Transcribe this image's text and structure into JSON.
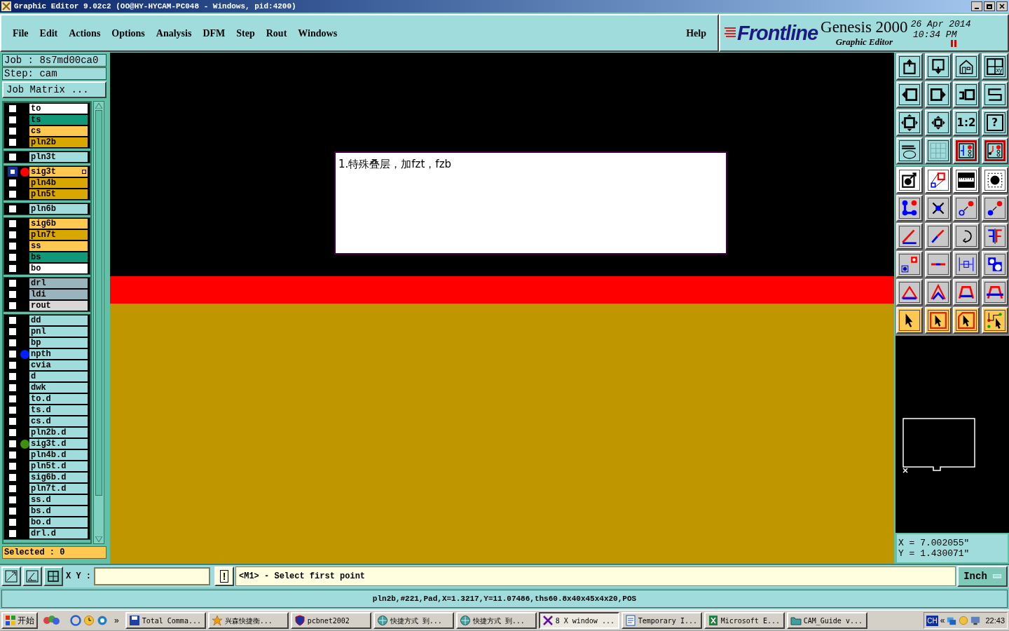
{
  "window": {
    "title": "Graphic Editor 9.02c2 (OO@HY-HYCAM-PC048 - Windows, pid:4200)"
  },
  "menu": {
    "items": [
      "File",
      "Edit",
      "Actions",
      "Options",
      "Analysis",
      "DFM",
      "Step",
      "Rout",
      "Windows"
    ],
    "help": "Help"
  },
  "branding": {
    "logo": "Frontline",
    "product": "Genesis 2000",
    "subtitle": "Graphic Editor",
    "date": "26 Apr 2014",
    "time": "10:34 PM"
  },
  "job": {
    "job": "Job : 8s7md00ca0",
    "step": "Step: cam",
    "matrix_button": "Job Matrix ..."
  },
  "layer_groups": [
    [
      {
        "name": "to",
        "color": "#ffffff",
        "active": false
      },
      {
        "name": "ts",
        "color": "#109878",
        "active": false
      },
      {
        "name": "cs",
        "color": "#ffc850",
        "active": false
      },
      {
        "name": "pln2b",
        "color": "#d8a800",
        "active": false
      }
    ],
    [
      {
        "name": "pln3t",
        "color": "#a0dcdc",
        "active": false
      }
    ],
    [
      {
        "name": "sig3t",
        "color": "#ffc850",
        "active": true,
        "marker": {
          "color": "#ff0000"
        }
      },
      {
        "name": "pln4b",
        "color": "#d8a800",
        "active": false
      },
      {
        "name": "pln5t",
        "color": "#d8a800",
        "active": false
      }
    ],
    [
      {
        "name": "pln6b",
        "color": "#a0dcdc",
        "active": false
      }
    ],
    [
      {
        "name": "sig6b",
        "color": "#ffc850",
        "active": false
      },
      {
        "name": "pln7t",
        "color": "#d8a800",
        "active": false
      },
      {
        "name": "ss",
        "color": "#ffc850",
        "active": false
      },
      {
        "name": "bs",
        "color": "#109878",
        "active": false
      },
      {
        "name": "bo",
        "color": "#ffffff",
        "active": false
      }
    ],
    [
      {
        "name": "drl",
        "color": "#98b4bc",
        "active": false
      },
      {
        "name": "ldi",
        "color": "#98b4bc",
        "active": false
      },
      {
        "name": "rout",
        "color": "#d8d8d8",
        "active": false
      }
    ],
    [
      {
        "name": "dd",
        "color": "#a0dcdc",
        "active": false
      },
      {
        "name": "pnl",
        "color": "#a0dcdc",
        "active": false
      },
      {
        "name": "bp",
        "color": "#a0dcdc",
        "active": false
      },
      {
        "name": "npth",
        "color": "#a0dcdc",
        "active": false,
        "marker": {
          "color": "#0020ff"
        }
      },
      {
        "name": "cvia",
        "color": "#a0dcdc",
        "active": false
      },
      {
        "name": "d",
        "color": "#a0dcdc",
        "active": false
      },
      {
        "name": "dwk",
        "color": "#a0dcdc",
        "active": false
      },
      {
        "name": "to.d",
        "color": "#a0dcdc",
        "active": false
      },
      {
        "name": "ts.d",
        "color": "#a0dcdc",
        "active": false
      },
      {
        "name": "cs.d",
        "color": "#a0dcdc",
        "active": false
      },
      {
        "name": "pln2b.d",
        "color": "#a0dcdc",
        "active": false
      },
      {
        "name": "sig3t.d",
        "color": "#a0dcdc",
        "active": false,
        "marker": {
          "color": "#409010"
        }
      },
      {
        "name": "pln4b.d",
        "color": "#a0dcdc",
        "active": false
      },
      {
        "name": "pln5t.d",
        "color": "#a0dcdc",
        "active": false
      },
      {
        "name": "sig6b.d",
        "color": "#a0dcdc",
        "active": false
      },
      {
        "name": "pln7t.d",
        "color": "#a0dcdc",
        "active": false
      },
      {
        "name": "ss.d",
        "color": "#a0dcdc",
        "active": false
      },
      {
        "name": "bs.d",
        "color": "#a0dcdc",
        "active": false
      },
      {
        "name": "bo.d",
        "color": "#a0dcdc",
        "active": false
      },
      {
        "name": "drl.d",
        "color": "#a0dcdc",
        "active": false
      }
    ]
  ],
  "selected_count": "Selected : 0",
  "canvas": {
    "note": "1.特殊叠层，加fzt，fzb"
  },
  "view_tools": [
    {
      "kind": "up",
      "on": false
    },
    {
      "kind": "down",
      "on": false
    },
    {
      "kind": "home",
      "on": false
    },
    {
      "kind": "panes",
      "on": false,
      "label": "xy"
    },
    {
      "kind": "left",
      "on": false
    },
    {
      "kind": "right",
      "on": false
    },
    {
      "kind": "undo",
      "on": false
    },
    {
      "kind": "snake",
      "on": false
    },
    {
      "kind": "fit",
      "on": false
    },
    {
      "kind": "center",
      "on": false
    },
    {
      "kind": "ratio",
      "on": false,
      "label": "1:2"
    },
    {
      "kind": "help",
      "on": false,
      "label": "?"
    },
    {
      "kind": "palette",
      "on": false
    },
    {
      "kind": "grid",
      "on": false
    },
    {
      "kind": "circuit",
      "on": true
    },
    {
      "kind": "circuit2",
      "on": true
    }
  ],
  "edit_tools": [
    {
      "kind": "add-pad"
    },
    {
      "kind": "transform"
    },
    {
      "kind": "ruler"
    },
    {
      "kind": "pad"
    },
    {
      "kind": "nodes"
    },
    {
      "kind": "cross"
    },
    {
      "kind": "move-ring"
    },
    {
      "kind": "move-dot"
    },
    {
      "kind": "angle"
    },
    {
      "kind": "split"
    },
    {
      "kind": "rotate"
    },
    {
      "kind": "mirror"
    },
    {
      "kind": "move-pad"
    },
    {
      "kind": "break"
    },
    {
      "kind": "dimension"
    },
    {
      "kind": "shapes"
    },
    {
      "kind": "triangle"
    },
    {
      "kind": "peak"
    },
    {
      "kind": "arch"
    },
    {
      "kind": "arch-cross"
    },
    {
      "kind": "pointer"
    },
    {
      "kind": "pointer-frame"
    },
    {
      "kind": "pointer-poly"
    },
    {
      "kind": "route"
    }
  ],
  "coordinates": {
    "x": "X = 7.002055\"",
    "y": "Y = 1.430071\""
  },
  "command_bar": {
    "xy_label": "X Y :",
    "prompt_button": "!",
    "message": "<M1> - Select first point",
    "units": "Inch"
  },
  "status_line": "pln2b,#221,Pad,X=1.3217,Y=11.07486,ths60.8x40x45x4x20,POS",
  "taskbar": {
    "start": "开始",
    "overflow": "»",
    "tasks": [
      {
        "kind": "disk",
        "label": "Total Comma...",
        "selected": false
      },
      {
        "kind": "star",
        "label": "兴森快捷衡...",
        "selected": false
      },
      {
        "kind": "shield",
        "label": "pcbnet2002",
        "selected": false
      },
      {
        "kind": "shortcut",
        "label": "快捷方式 到...",
        "selected": false
      },
      {
        "kind": "shortcut",
        "label": "快捷方式 到...",
        "selected": false
      },
      {
        "kind": "xwin",
        "label": "8 X window ...",
        "selected": true
      },
      {
        "kind": "doc",
        "label": "Temporary I...",
        "selected": false
      },
      {
        "kind": "sheet",
        "label": "Microsoft E...",
        "selected": false
      },
      {
        "kind": "folder",
        "label": "CAM_Guide v...",
        "selected": false
      }
    ],
    "language": "CH",
    "tray_toggle": "«",
    "clock": "22:43"
  }
}
